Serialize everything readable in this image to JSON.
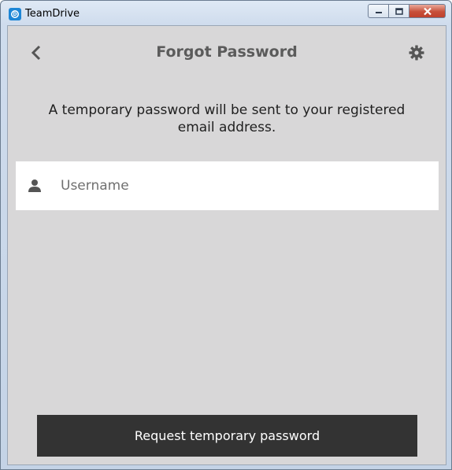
{
  "window": {
    "title": "TeamDrive"
  },
  "header": {
    "title": "Forgot Password"
  },
  "info": {
    "text": "A temporary password will be sent to your registered email address."
  },
  "username": {
    "placeholder": "Username",
    "value": ""
  },
  "actions": {
    "request_label": "Request temporary password"
  },
  "icons": {
    "app": "teamdrive-logo-icon",
    "back": "chevron-left-icon",
    "settings": "gear-icon",
    "user": "user-icon"
  },
  "colors": {
    "background": "#d8d7d8",
    "title_text": "#5b5b5b",
    "button_bg": "#333333",
    "button_text": "#ffffff",
    "app_icon": "#1d86d6"
  }
}
